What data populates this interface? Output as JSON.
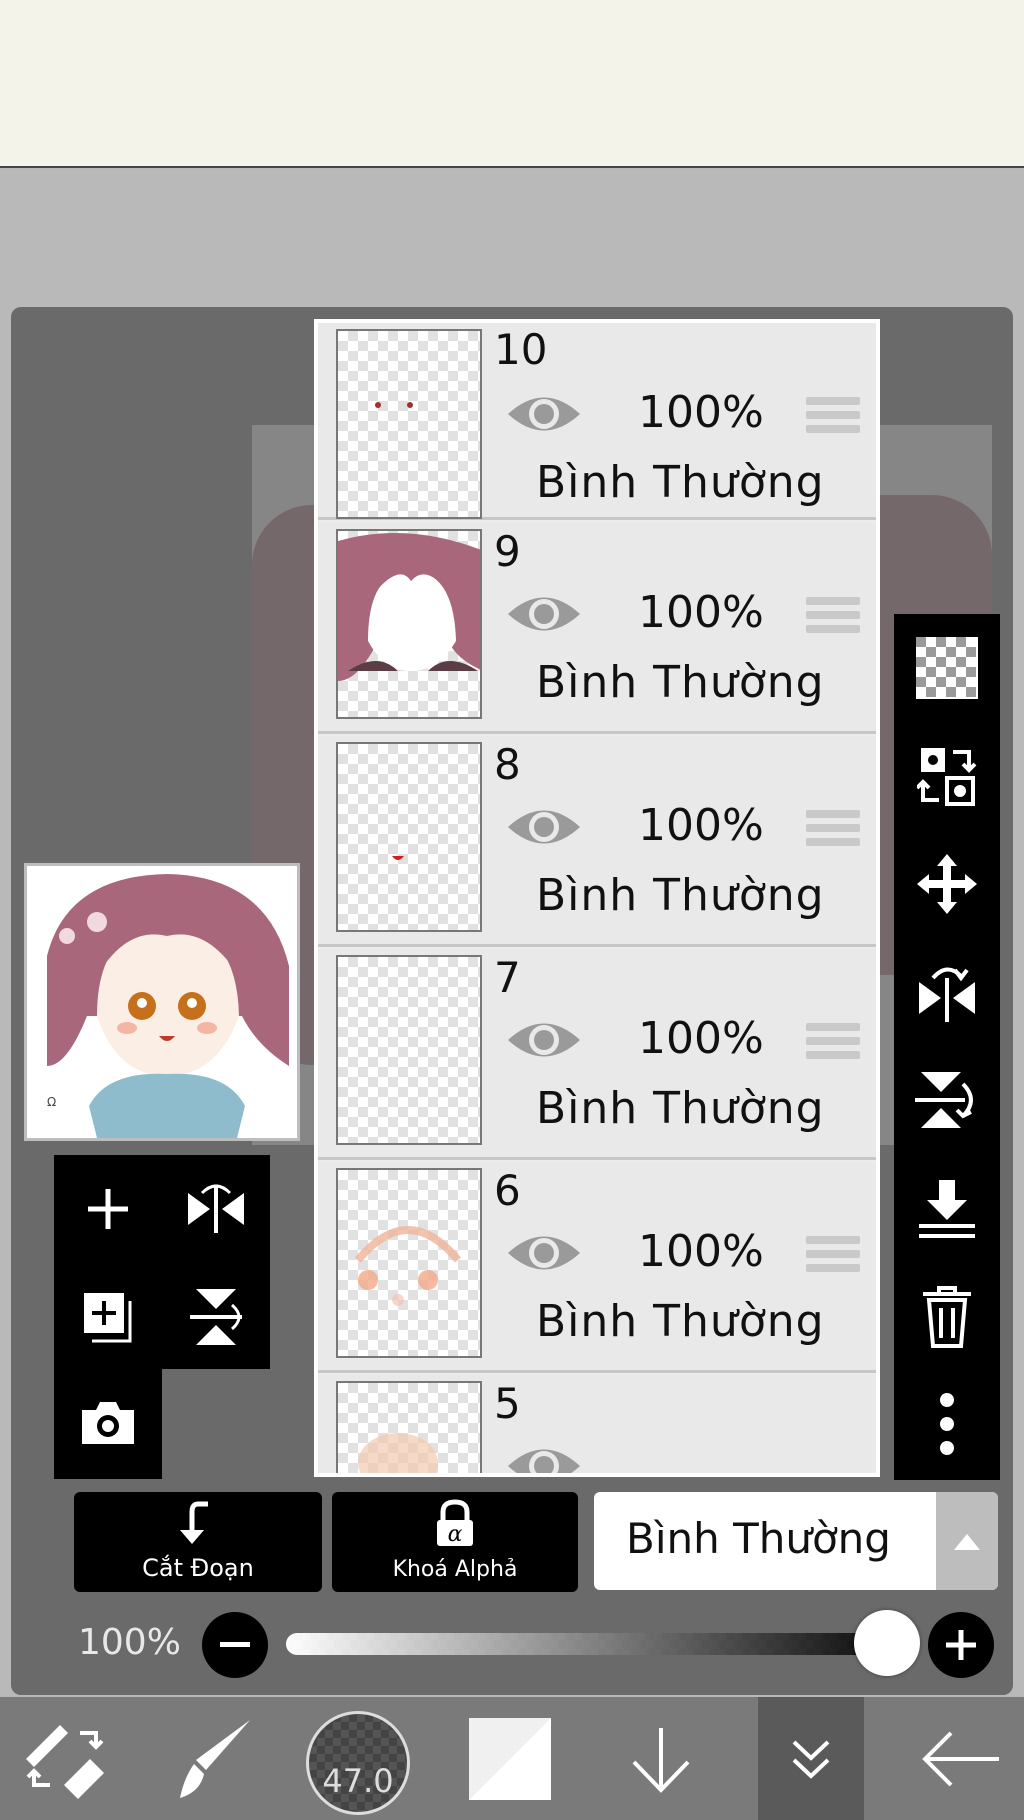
{
  "layers": [
    {
      "number": "10",
      "opacity": "100%",
      "blend": "Bình Thường"
    },
    {
      "number": "9",
      "opacity": "100%",
      "blend": "Bình Thường"
    },
    {
      "number": "8",
      "opacity": "100%",
      "blend": "Bình Thường"
    },
    {
      "number": "7",
      "opacity": "100%",
      "blend": "Bình Thường"
    },
    {
      "number": "6",
      "opacity": "100%",
      "blend": "Bình Thường"
    },
    {
      "number": "5",
      "opacity": "",
      "blend": ""
    }
  ],
  "actions": {
    "clipping_label": "Cắt Đoạn",
    "alpha_lock_label": "Khoá Alphả",
    "blend_mode_value": "Bình Thường"
  },
  "opacity": {
    "label": "100%",
    "value_percent": 100
  },
  "brush": {
    "size_label": "47.0"
  },
  "icons": {
    "right_bar": [
      "transparency-icon",
      "swap-layer-icon",
      "move-icon",
      "flip-horizontal-icon",
      "flip-vertical-icon",
      "merge-down-icon",
      "trash-icon",
      "more-vertical-icon"
    ],
    "mini_tools": [
      "add-layer-icon",
      "flip-layer-h-icon",
      "add-layer-copy-icon",
      "flip-layer-v-icon",
      "camera-icon"
    ],
    "bottom_bar": [
      "tool-switch-icon",
      "brush-icon",
      "brush-size",
      "color-swatch",
      "arrow-down-icon",
      "double-chevron-down-icon",
      "back-arrow-icon"
    ]
  }
}
